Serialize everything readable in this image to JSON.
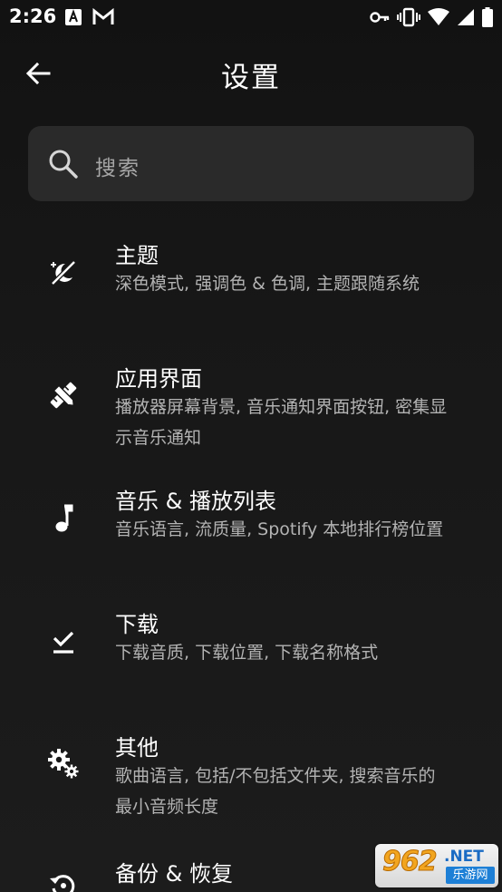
{
  "status_bar": {
    "time": "2:26"
  },
  "app_bar": {
    "title": "设置"
  },
  "search": {
    "placeholder": "搜索"
  },
  "settings": [
    {
      "title": "主题",
      "subtitle": "深色模式, 强调色 & 色调, 主题跟随系统",
      "icon": "theme-icon"
    },
    {
      "title": "应用界面",
      "subtitle": "播放器屏幕背景, 音乐通知界面按钮, 密集显示音乐通知",
      "icon": "design-tools-icon"
    },
    {
      "title": "音乐 & 播放列表",
      "subtitle": "音乐语言, 流质量, Spotify 本地排行榜位置",
      "icon": "music-note-icon"
    },
    {
      "title": "下载",
      "subtitle": "下载音质, 下载位置, 下载名称格式",
      "icon": "download-done-icon"
    },
    {
      "title": "其他",
      "subtitle": "歌曲语言, 包括/不包括文件夹, 搜索音乐的最小音频长度",
      "icon": "settings-gears-icon"
    },
    {
      "title": "备份 & 恢复",
      "subtitle": "",
      "icon": "restore-icon"
    }
  ],
  "watermark": {
    "number": "962",
    "domain": ".NET",
    "site": "乐游网"
  }
}
